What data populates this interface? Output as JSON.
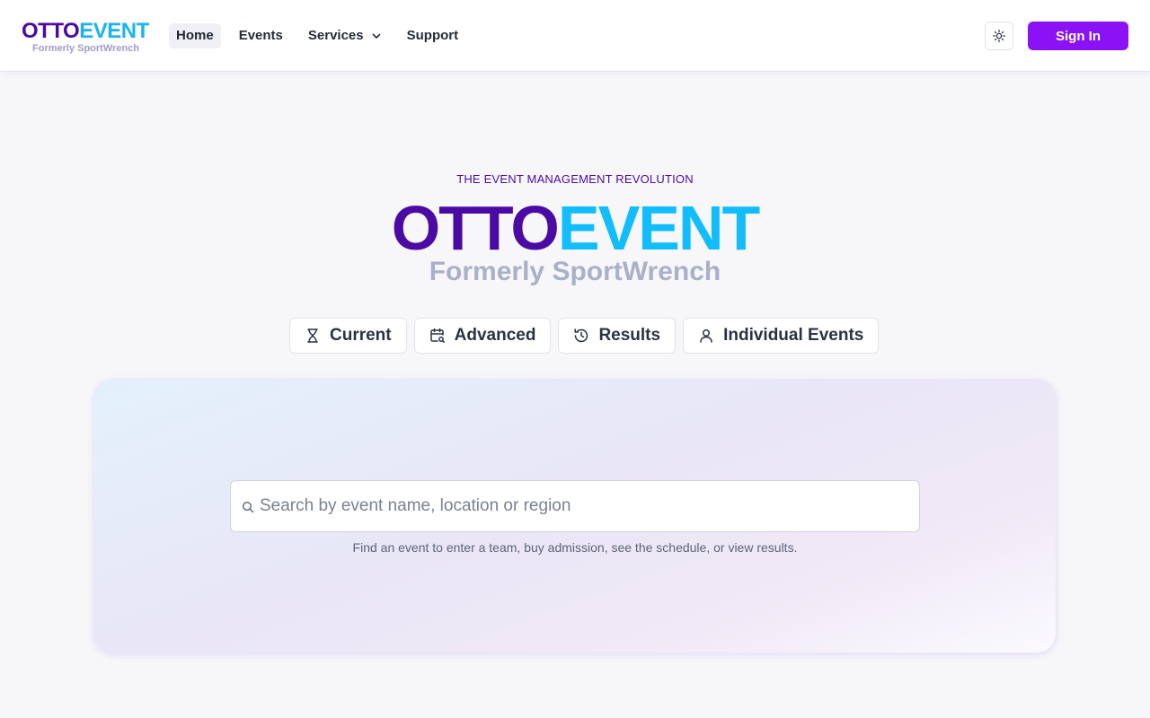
{
  "brand": {
    "otto": "OTTO",
    "event": "EVENT",
    "sub": "Formerly SportWrench"
  },
  "nav": {
    "home": "Home",
    "events": "Events",
    "services": "Services",
    "support": "Support"
  },
  "header": {
    "theme_icon": "sun-icon",
    "signin_label": "Sign In"
  },
  "hero": {
    "tagline": "THE EVENT MANAGEMENT REVOLUTION",
    "logo_otto": "OTTO",
    "logo_event": "EVENT",
    "logo_sub": "Formerly SportWrench"
  },
  "tabs": [
    {
      "label": "Current",
      "icon": "hourglass-icon"
    },
    {
      "label": "Advanced",
      "icon": "calendar-search-icon"
    },
    {
      "label": "Results",
      "icon": "history-icon"
    },
    {
      "label": "Individual Events",
      "icon": "user-icon"
    }
  ],
  "search": {
    "placeholder": "Search by event name, location or region",
    "value": "",
    "helper": "Find an event to enter a team, buy admission, see the schedule, or view results."
  },
  "colors": {
    "brand_purple": "#4b0aa3",
    "brand_cyan": "#12bdfb",
    "accent": "#8a12f4"
  }
}
